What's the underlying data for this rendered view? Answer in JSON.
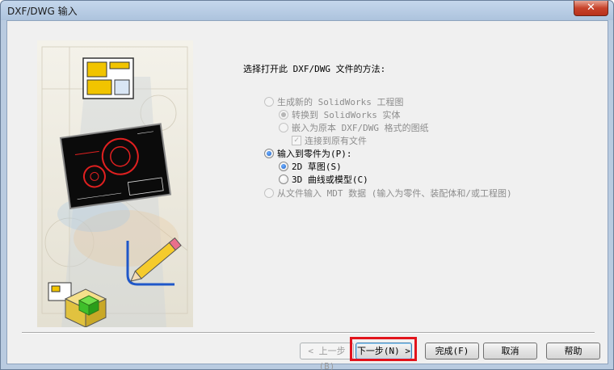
{
  "window": {
    "title": "DXF/DWG 输入",
    "close_glyph": "✕"
  },
  "prompt": "选择打开此 DXF/DWG 文件的方法:",
  "options": {
    "create_drawing": "生成新的 SolidWorks 工程图",
    "convert_entities": "转换到 SolidWorks 实体",
    "embed_sheet": "嵌入为原本 DXF/DWG 格式的图纸",
    "link_original": "连接到原有文件",
    "import_to_part": "输入到零件为(P):",
    "sketch_2d": "2D 草图(S)",
    "curves_3d": "3D 曲线或模型(C)",
    "import_mdt": "从文件输入 MDT 数据 (输入为零件、装配体和/或工程图)"
  },
  "state": {
    "selected_mode": "import_to_part",
    "selected_part_type": "sketch_2d",
    "link_original_checked": true
  },
  "buttons": {
    "back": "< 上一步(B)",
    "next": "下一步(N) >",
    "finish": "完成(F)",
    "cancel": "取消",
    "help": "帮助"
  },
  "colors": {
    "highlight": "#e2141c",
    "title_bar": "#b9cbe0",
    "dialog_bg": "#f0f0f0"
  },
  "icons": {
    "illustration": "cad-import-illustration",
    "close": "close-icon"
  }
}
